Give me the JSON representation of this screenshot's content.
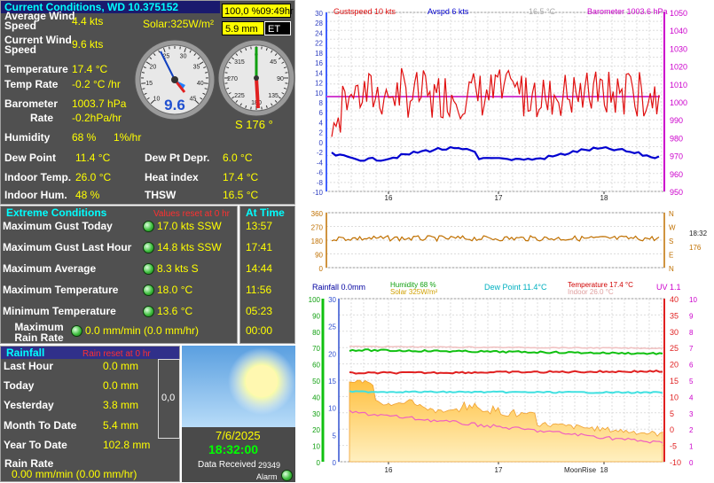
{
  "current": {
    "title": "Current Conditions, WD 10.375152",
    "time_box": "100,0 %09:49hr",
    "rain_box": "5.9 mm",
    "et_label": "ET",
    "solar": "Solar:325W/m²",
    "rows": [
      {
        "label": "Average Wind Speed",
        "value": "4.4 kts"
      },
      {
        "label": "Current Wind Speed",
        "value": "9.6 kts"
      },
      {
        "label": "Temperature",
        "value": "17.4 °C"
      },
      {
        "label": "Temp Rate",
        "value": "-0.2 °C /hr"
      },
      {
        "label": "Barometer",
        "value": "1003.7 hPa"
      },
      {
        "label": "Rate",
        "value": "-0.2hPa/hr"
      },
      {
        "label": "Humidity",
        "value": "68 %",
        "extra": "1%/hr"
      },
      {
        "label": "Dew Point",
        "value": "11.4 °C"
      },
      {
        "label": "Dew Pt Depr.",
        "value": "6.0 °C"
      },
      {
        "label": "Indoor Temp.",
        "value": "26.0 °C"
      },
      {
        "label": "Heat index",
        "value": "17.4 °C"
      },
      {
        "label": "Indoor Hum.",
        "value": "48 %"
      },
      {
        "label": "THSW",
        "value": "16.5 °C"
      }
    ],
    "wind_dial_value": "9.6",
    "wind_dial_ticks": [
      "10",
      "15",
      "20",
      "25",
      "30",
      "35",
      "40",
      "45"
    ],
    "dir_dial_ticks": [
      "0",
      "45",
      "90",
      "135",
      "180",
      "225",
      "270",
      "315",
      "360"
    ],
    "direction": "S  176 °"
  },
  "extremes": {
    "title": "Extreme Conditions",
    "reset_note": "Values reset at 0 hr",
    "time_title": "At Time",
    "rows": [
      {
        "label": "Maximum Gust Today",
        "value": "17.0 kts SSW",
        "time": "13:57"
      },
      {
        "label": "Maximum Gust Last Hour",
        "value": "14.8 kts SSW",
        "time": "17:41"
      },
      {
        "label": "Maximum Average",
        "value": "8.3 kts   S",
        "time": "14:44"
      },
      {
        "label": "Maximum Temperature",
        "value": "18.0 °C",
        "time": "11:56"
      },
      {
        "label": "Minimum Temperature",
        "value": "13.6 °C",
        "time": "05:23"
      },
      {
        "label": "Maximum Rain Rate",
        "value": "0.0 mm/min (0.0 mm/hr)",
        "time": "00:00"
      }
    ]
  },
  "rainfall": {
    "title": "Rainfall",
    "reset_note": "Rain reset at 0 hr",
    "rows": [
      {
        "label": "Last Hour",
        "value": "0.0 mm"
      },
      {
        "label": "Today",
        "value": "0.0 mm"
      },
      {
        "label": "Yesterday",
        "value": "3.8 mm"
      },
      {
        "label": "Month To Date",
        "value": "5.4 mm"
      },
      {
        "label": "Year To Date",
        "value": "102.8 mm"
      }
    ],
    "rate_label": "Rain Rate",
    "rate_value": "0.00 mm/min (0.00 mm/hr)",
    "gauge_value": "0,0"
  },
  "status": {
    "date": "7/6/2025",
    "time": "18:32:00",
    "data_received_label": "Data Received",
    "data_received_count": "29349",
    "alarm_label": "Alarm"
  },
  "graph1": {
    "legend_gust": "Gustspeed  10 kts",
    "legend_avg": "Avspd  6 kts",
    "legend_temp": "16.5 °C",
    "legend_baro": "Barometer  1003.6 hPa",
    "left_ticks": [
      "30",
      "28",
      "24",
      "22",
      "18",
      "16",
      "14",
      "12",
      "10",
      "8",
      "6",
      "4",
      "2",
      "0",
      "-2",
      "-4",
      "-6",
      "-8",
      "-10"
    ],
    "left_ticks2": [
      "4",
      "4",
      "2",
      "0"
    ],
    "right_ticks": [
      "1050",
      "1040",
      "1030",
      "1020",
      "1010",
      "1000",
      "990",
      "980",
      "970",
      "960",
      "950"
    ],
    "x_ticks": [
      "16",
      "17",
      "18"
    ],
    "colors": {
      "gust": "#e01010",
      "avg": "#0000d0",
      "baro": "#d030d0",
      "axis_right": "#cc00cc"
    }
  },
  "graph2": {
    "left_ticks": [
      "360",
      "270",
      "180",
      "90",
      "0"
    ],
    "compass": [
      "N",
      "W",
      "S",
      "E",
      "N"
    ],
    "time": "18:32",
    "value": "176"
  },
  "graph3": {
    "legend_rain": "Rainfall  0.0mm",
    "legend_humidity": "Humidity  68 %",
    "legend_solar": "Solar  325W/m²",
    "legend_dew": "Dew Point  11.4°C",
    "legend_temp": "Temperature  17.4 °C",
    "legend_indoor": "Indoor  26.0 °C",
    "legend_uv": "UV  1.1",
    "left_green": [
      "100",
      "90",
      "80",
      "70",
      "60",
      "50",
      "40",
      "30",
      "20",
      "10",
      "0"
    ],
    "left_blue": [
      "30",
      "25",
      "20",
      "15",
      "10",
      "5",
      "0"
    ],
    "right_red": [
      "40",
      "35",
      "30",
      "25",
      "20",
      "15",
      "10",
      "5",
      "0",
      "-5",
      "-10"
    ],
    "right_uv": [
      "10",
      "9",
      "8",
      "7",
      "6",
      "5",
      "4",
      "3",
      "2",
      "1",
      "0"
    ],
    "x_ticks": [
      "16",
      "17",
      "18"
    ],
    "moonrise": "MoonRise"
  }
}
